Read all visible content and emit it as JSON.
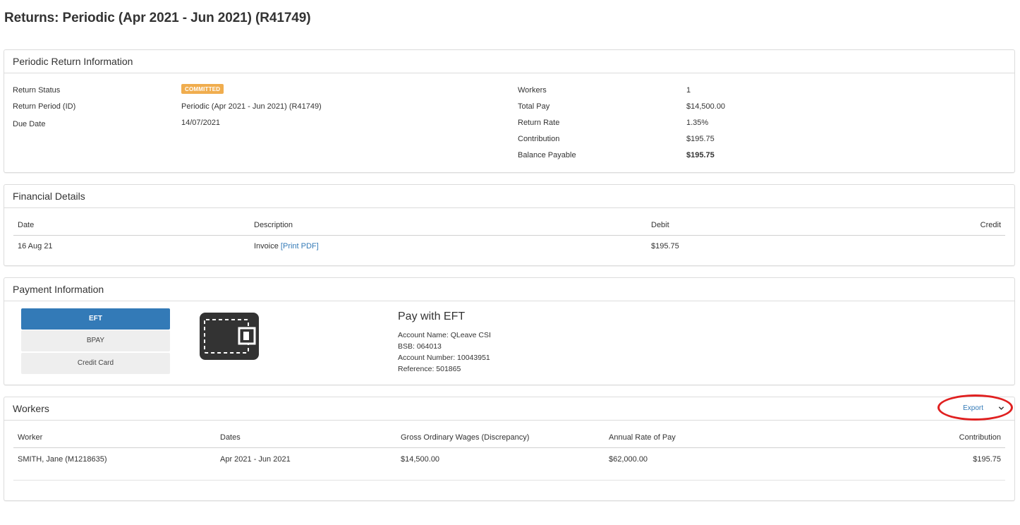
{
  "page": {
    "title": "Returns: Periodic (Apr 2021 - Jun 2021) (R41749)"
  },
  "info": {
    "heading": "Periodic Return Information",
    "left": [
      {
        "label": "Return Status",
        "value": "COMMITTED"
      },
      {
        "label": "Return Period (ID)",
        "value": "Periodic (Apr 2021 - Jun 2021) (R41749)"
      },
      {
        "label": "Due Date",
        "value": "14/07/2021"
      }
    ],
    "right": [
      {
        "label": "Workers",
        "value": "1"
      },
      {
        "label": "Total Pay",
        "value": "$14,500.00"
      },
      {
        "label": "Return Rate",
        "value": "1.35%"
      },
      {
        "label": "Contribution",
        "value": "$195.75"
      },
      {
        "label": "Balance Payable",
        "value": "$195.75"
      }
    ],
    "status_color": "#f0ad4e"
  },
  "financial": {
    "heading": "Financial Details",
    "columns": [
      "Date",
      "Description",
      "Debit",
      "Credit"
    ],
    "rows": [
      {
        "date": "16 Aug 21",
        "description": "Invoice",
        "link": "[Print PDF]",
        "debit": "$195.75",
        "credit": ""
      }
    ]
  },
  "payment": {
    "heading": "Payment Information",
    "methods": [
      "EFT",
      "BPAY",
      "Credit Card"
    ],
    "selected": "EFT",
    "icon": "wallet-icon",
    "title": "Pay with EFT",
    "details": [
      "Account Name: QLeave CSI",
      "BSB: 064013",
      "Account Number: 10043951",
      "Reference: 501865"
    ],
    "accent": "#337ab7"
  },
  "workers": {
    "heading": "Workers",
    "export_label": "Export",
    "columns": [
      "Worker",
      "Dates",
      "Gross Ordinary Wages (Discrepancy)",
      "Annual Rate of Pay",
      "Contribution"
    ],
    "rows": [
      {
        "worker": "SMITH, Jane (M1218635)",
        "dates": "Apr 2021 - Jun 2021",
        "gross": "$14,500.00",
        "annual": "$62,000.00",
        "contribution": "$195.75"
      }
    ],
    "highlight_color": "#e02020"
  }
}
